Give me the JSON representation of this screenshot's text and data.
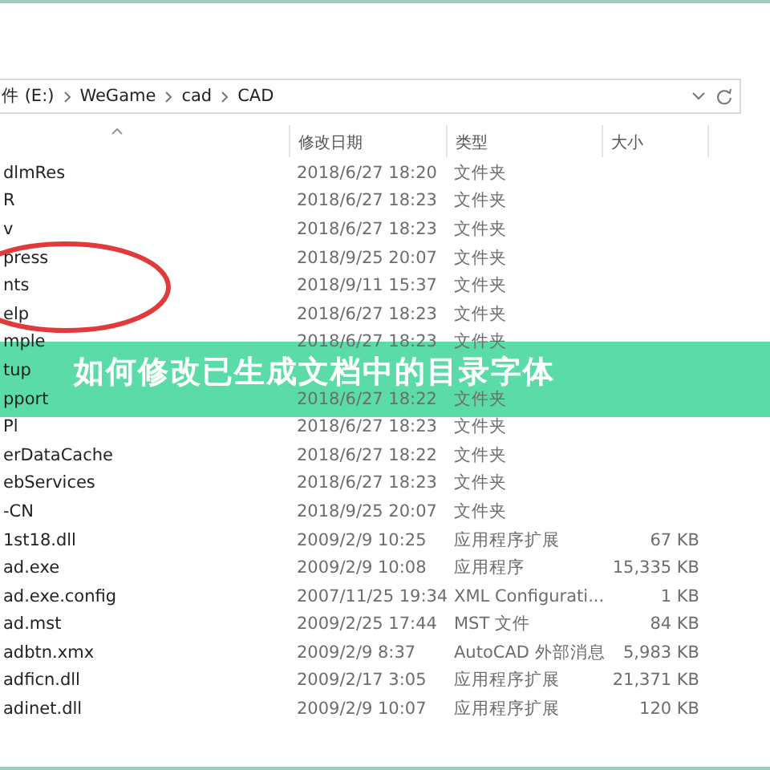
{
  "address_bar": {
    "segments": [
      "件 (E:)",
      "WeGame",
      "cad",
      "CAD"
    ]
  },
  "columns": [
    {
      "label": "修改日期"
    },
    {
      "label": "类型"
    },
    {
      "label": "大小"
    }
  ],
  "rows": [
    {
      "name": "dlmRes",
      "date": "2018/6/27 18:20",
      "type": "文件夹"
    },
    {
      "name": "R",
      "date": "2018/6/27 18:23",
      "type": "文件夹"
    },
    {
      "name": "v",
      "date": "2018/6/27 18:23",
      "type": "文件夹"
    },
    {
      "name": "press",
      "date": "2018/9/25 20:07",
      "type": "文件夹"
    },
    {
      "name": "nts",
      "date": "2018/9/11 15:37",
      "type": "文件夹"
    },
    {
      "name": "elp",
      "date": "2018/6/27 18:23",
      "type": "文件夹"
    },
    {
      "name": "mple",
      "date": "2018/6/27 18:23",
      "type": "文件夹"
    },
    {
      "name": "tup"
    },
    {
      "name": "pport",
      "date": "2018/6/27 18:22",
      "type": "文件夹"
    },
    {
      "name": "Pl",
      "date": "2018/6/27 18:23",
      "type": "文件夹"
    },
    {
      "name": "erDataCache",
      "date": "2018/6/27 18:22",
      "type": "文件夹"
    },
    {
      "name": "ebServices",
      "date": "2018/6/27 18:23",
      "type": "文件夹"
    },
    {
      "name": "-CN",
      "date": "2018/9/25 20:07",
      "type": "文件夹"
    },
    {
      "name": "1st18.dll",
      "date": "2009/2/9 10:25",
      "type": "应用程序扩展",
      "size": "67 KB"
    },
    {
      "name": "ad.exe",
      "date": "2009/2/9 10:08",
      "type": "应用程序",
      "size": "15,335 KB"
    },
    {
      "name": "ad.exe.config",
      "date": "2007/11/25 19:34",
      "type": "XML Configurati...",
      "size": "1 KB"
    },
    {
      "name": "ad.mst",
      "date": "2009/2/25 17:44",
      "type": "MST 文件",
      "size": "84 KB"
    },
    {
      "name": "adbtn.xmx",
      "date": "2009/2/9 8:37",
      "type": "AutoCAD 外部消息",
      "size": "5,983 KB"
    },
    {
      "name": "adficn.dll",
      "date": "2009/2/17 3:05",
      "type": "应用程序扩展",
      "size": "21,371 KB"
    },
    {
      "name": "adinet.dll",
      "date": "2009/2/9 10:07",
      "type": "应用程序扩展",
      "size": "120 KB"
    }
  ],
  "banner": {
    "title": "如何修改已生成文档中的目录字体"
  }
}
